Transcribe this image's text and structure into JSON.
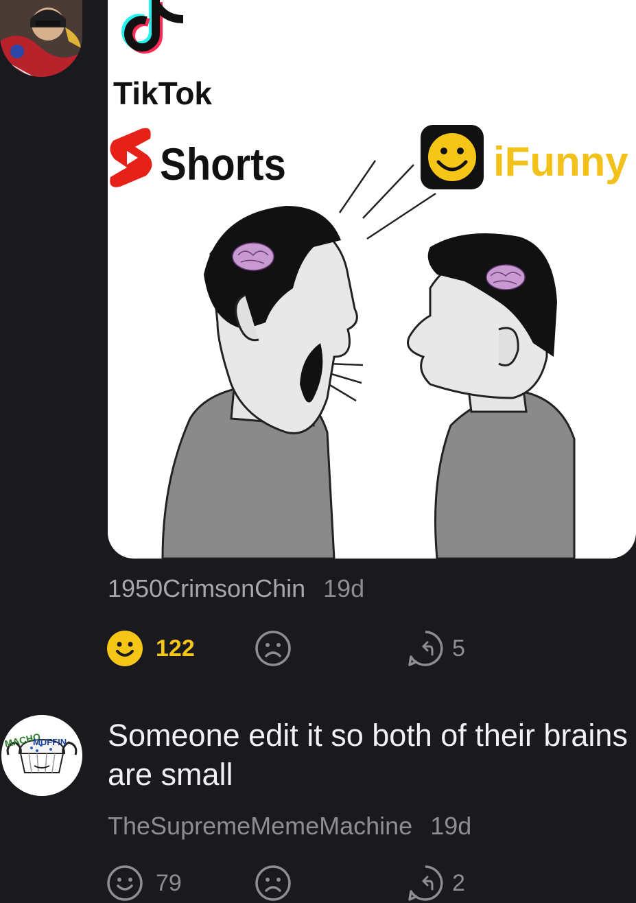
{
  "post": {
    "meme": {
      "tiktok_label": "TikTok",
      "shorts_label": "Shorts",
      "ifunny_label": "iFunny"
    },
    "author": "1950CrimsonChin",
    "time": "19d",
    "smile_count": "122",
    "reply_count": "5",
    "smile_active": true,
    "accent_color": "#f5c518"
  },
  "comment": {
    "text": "Someone edit it so both of their brains are small",
    "author": "TheSupremeMemeMachine",
    "time": "19d",
    "smile_count": "79",
    "reply_count": "2",
    "avatar_text": "MACHO MUFFIN"
  }
}
